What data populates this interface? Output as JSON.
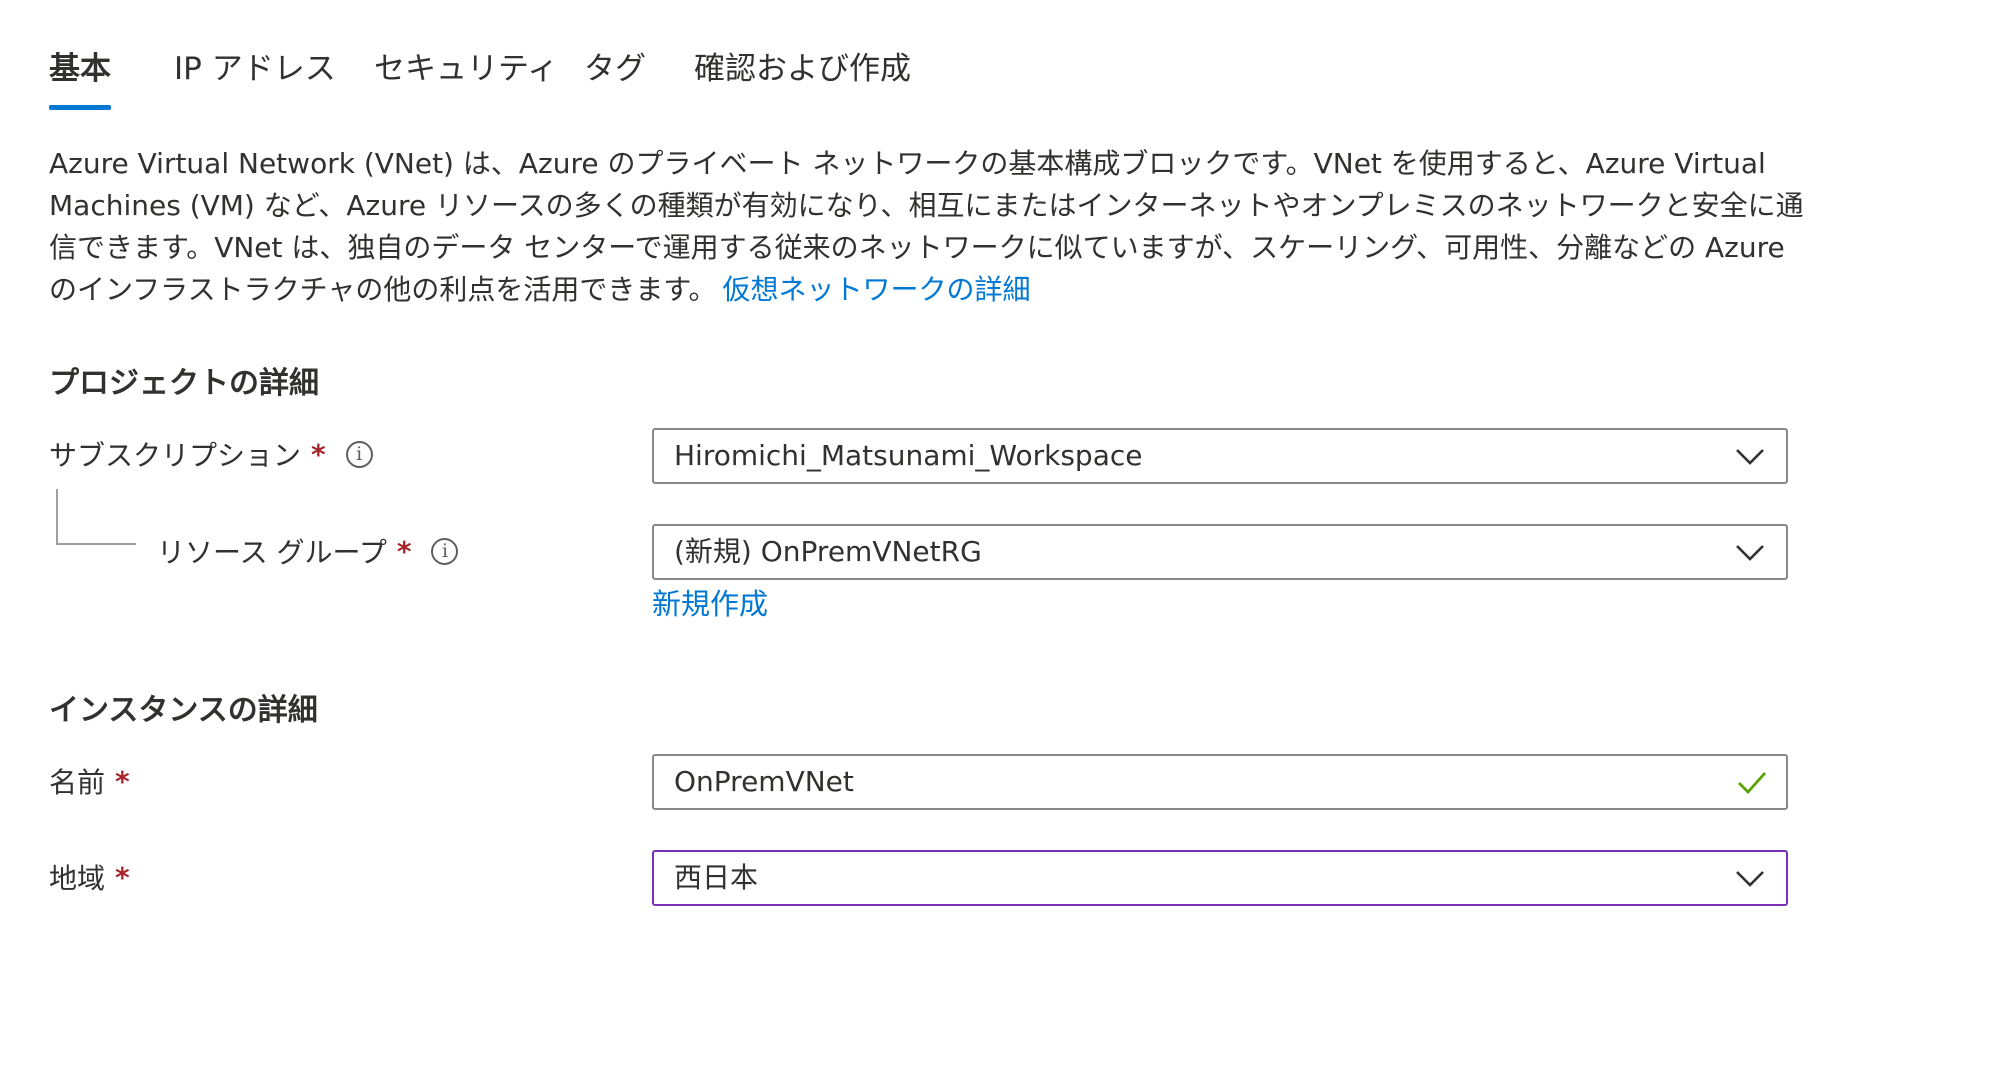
{
  "tabs": [
    {
      "label": "基本",
      "active": true
    },
    {
      "label": "IP アドレス",
      "active": false
    },
    {
      "label": "セキュリティ",
      "active": false
    },
    {
      "label": "タグ",
      "active": false
    },
    {
      "label": "確認および作成",
      "active": false
    }
  ],
  "description": {
    "text": "Azure Virtual Network (VNet) は、Azure のプライベート ネットワークの基本構成ブロックです。VNet を使用すると、Azure Virtual Machines (VM) など、Azure リソースの多くの種類が有効になり、相互にまたはインターネットやオンプレミスのネットワークと安全に通信できます。VNet は、独自のデータ センターで運用する従来のネットワークに似ていますが、スケーリング、可用性、分離などの Azure のインフラストラクチャの他の利点を活用できます。",
    "link": "仮想ネットワークの詳細"
  },
  "project": {
    "title": "プロジェクトの詳細",
    "subscription_label": "サブスクリプション",
    "subscription_value": "Hiromichi_Matsunami_Workspace",
    "resource_group_label": "リソース グループ",
    "resource_group_value": "(新規) OnPremVNetRG",
    "create_new_link": "新規作成"
  },
  "instance": {
    "title": "インスタンスの詳細",
    "name_label": "名前",
    "name_value": "OnPremVNet",
    "region_label": "地域",
    "region_value": "西日本"
  },
  "required_marker": "*",
  "info_glyph": "i",
  "colors": {
    "accent": "#0078d4",
    "required": "#a4262c",
    "valid_check": "#57a300",
    "focus_border": "#7b2fb7"
  },
  "icons": {
    "dropdown": "chevron-down-icon",
    "info": "info-icon",
    "valid": "checkmark-icon"
  }
}
